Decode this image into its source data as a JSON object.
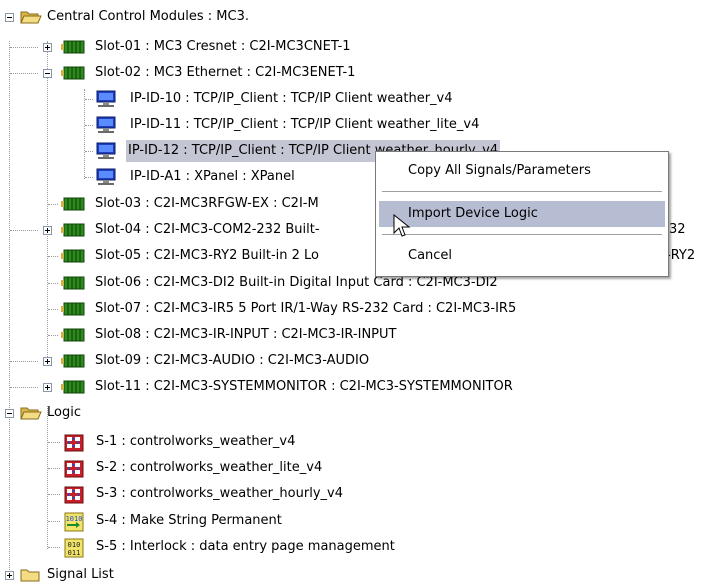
{
  "tree": {
    "root": {
      "label": "Central Control Modules : MC3.",
      "slots": [
        {
          "label": "Slot-01 : MC3 Cresnet : C2I-MC3CNET-1"
        },
        {
          "label": "Slot-02 : MC3 Ethernet : C2I-MC3ENET-1"
        },
        {
          "label": "Slot-03 : C2I-MC3RFGW-EX : C2I-M"
        },
        {
          "label": "Slot-04 : C2I-MC3-COM2-232 Built-"
        },
        {
          "label": "Slot-05 : C2I-MC3-RY2 Built-in 2 Lo"
        },
        {
          "label": "Slot-06 : C2I-MC3-DI2 Built-in Digital Input Card : C2I-MC3-DI2"
        },
        {
          "label": "Slot-07 : C2I-MC3-IR5 5 Port IR/1-Way RS-232 Card : C2I-MC3-IR5"
        },
        {
          "label": "Slot-08 : C2I-MC3-IR-INPUT : C2I-MC3-IR-INPUT"
        },
        {
          "label": "Slot-09 : C2I-MC3-AUDIO : C2I-MC3-AUDIO"
        },
        {
          "label": "Slot-11 : C2I-MC3-SYSTEMMONITOR : C2I-MC3-SYSTEMMONITOR"
        }
      ],
      "ethernet_children": [
        {
          "label": "IP-ID-10 : TCP/IP_Client : TCP/IP Client weather_v4"
        },
        {
          "label": "IP-ID-11 : TCP/IP_Client : TCP/IP Client weather_lite_v4"
        },
        {
          "label": "IP-ID-12 : TCP/IP_Client : TCP/IP Client weather_hourly_v4"
        },
        {
          "label": "IP-ID-A1 : XPanel : XPanel"
        }
      ],
      "overflow": {
        "slot04_tail": "32",
        "slot05_tail": "-RY2"
      }
    },
    "logic": {
      "label": "Logic",
      "items": [
        {
          "label": "S-1 : controlworks_weather_v4"
        },
        {
          "label": "S-2 : controlworks_weather_lite_v4"
        },
        {
          "label": "S-3 : controlworks_weather_hourly_v4"
        },
        {
          "label": "S-4 : Make String Permanent"
        },
        {
          "label": "S-5 : Interlock : data entry page management"
        }
      ]
    },
    "signal_list": {
      "label": "Signal List"
    }
  },
  "context_menu": {
    "items": [
      {
        "label": "Copy All Signals/Parameters"
      },
      {
        "label": "Import Device Logic",
        "highlighted": true
      },
      {
        "label": "Cancel"
      }
    ]
  },
  "colors": {
    "selection": "#c5c6d3",
    "menu_highlight": "#b6bdd2",
    "folder": "#f0d36a",
    "module": "#2d8a1d"
  }
}
